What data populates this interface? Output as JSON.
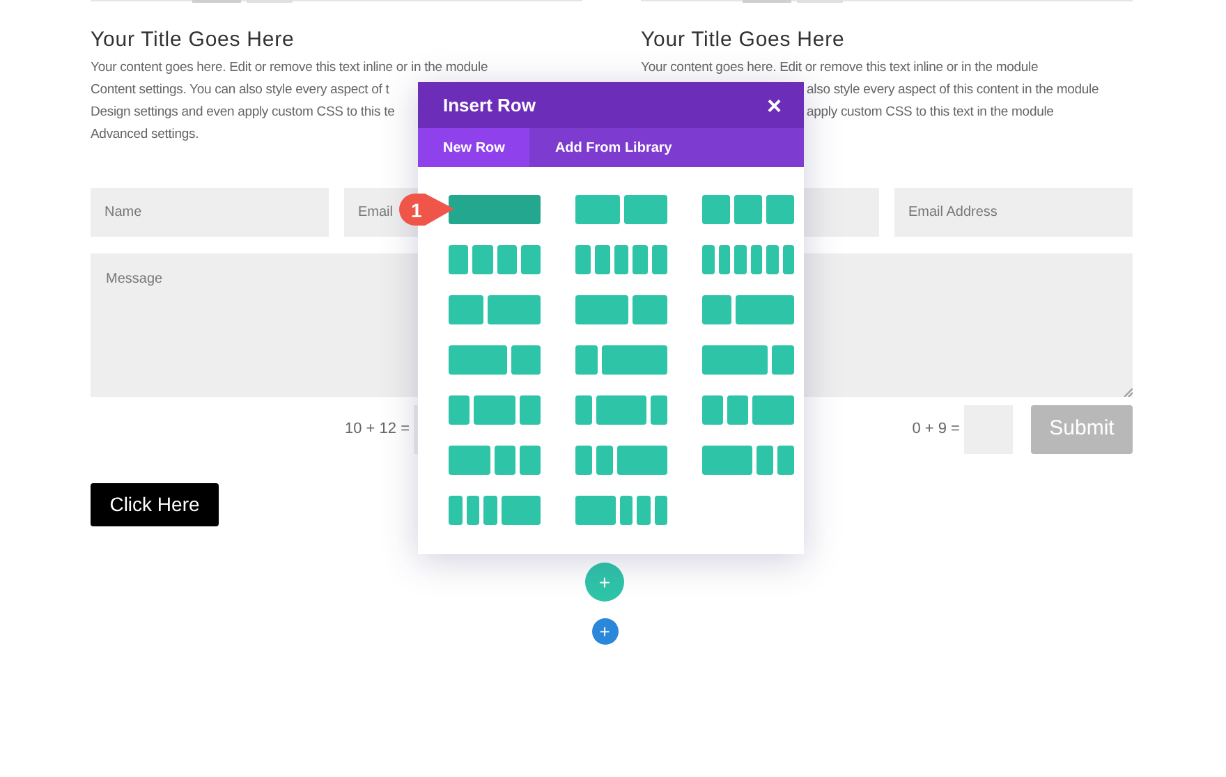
{
  "columns": [
    {
      "title": "Your Title Goes Here",
      "lines": [
        "Your content goes here. Edit or remove this text inline or in the module",
        "Content settings. You can also style every aspect of t",
        "Design settings and even apply custom CSS to this te",
        "Advanced settings."
      ],
      "form": {
        "fields": [
          {
            "placeholder": "Name"
          },
          {
            "placeholder": "Email"
          }
        ],
        "message": "Message",
        "captcha": "10 + 12 ="
      }
    },
    {
      "title": "Your Title Goes Here",
      "lines": [
        "Your content goes here. Edit or remove this text inline or in the module",
        "also style every aspect of this content in the module",
        "apply custom CSS to this text in the module"
      ],
      "form": {
        "fields": [
          {
            "placeholder": "Email Address"
          }
        ],
        "captcha": "0 + 9 =",
        "submit": "Submit"
      }
    }
  ],
  "button": "Click Here",
  "modal": {
    "title": "Insert Row",
    "close": "×",
    "tabs": [
      {
        "label": "New Row",
        "selected": true
      },
      {
        "label": "Add From Library",
        "selected": false
      }
    ],
    "layouts": [
      {
        "highlighted": true
      },
      {
        "highlighted": false
      },
      {
        "highlighted": false
      },
      {
        "highlighted": false
      },
      {
        "highlighted": false
      },
      {
        "highlighted": false
      },
      {
        "highlighted": false
      },
      {
        "highlighted": false
      },
      {
        "highlighted": false
      },
      {
        "highlighted": false
      },
      {
        "highlighted": false
      },
      {
        "highlighted": false
      },
      {
        "highlighted": false
      },
      {
        "highlighted": false
      },
      {
        "highlighted": false
      },
      {
        "highlighted": false
      },
      {
        "highlighted": false
      },
      {
        "highlighted": false
      },
      {
        "highlighted": false
      },
      {
        "highlighted": false
      }
    ],
    "callout": "1"
  },
  "add_buttons": [
    "+",
    "+"
  ]
}
